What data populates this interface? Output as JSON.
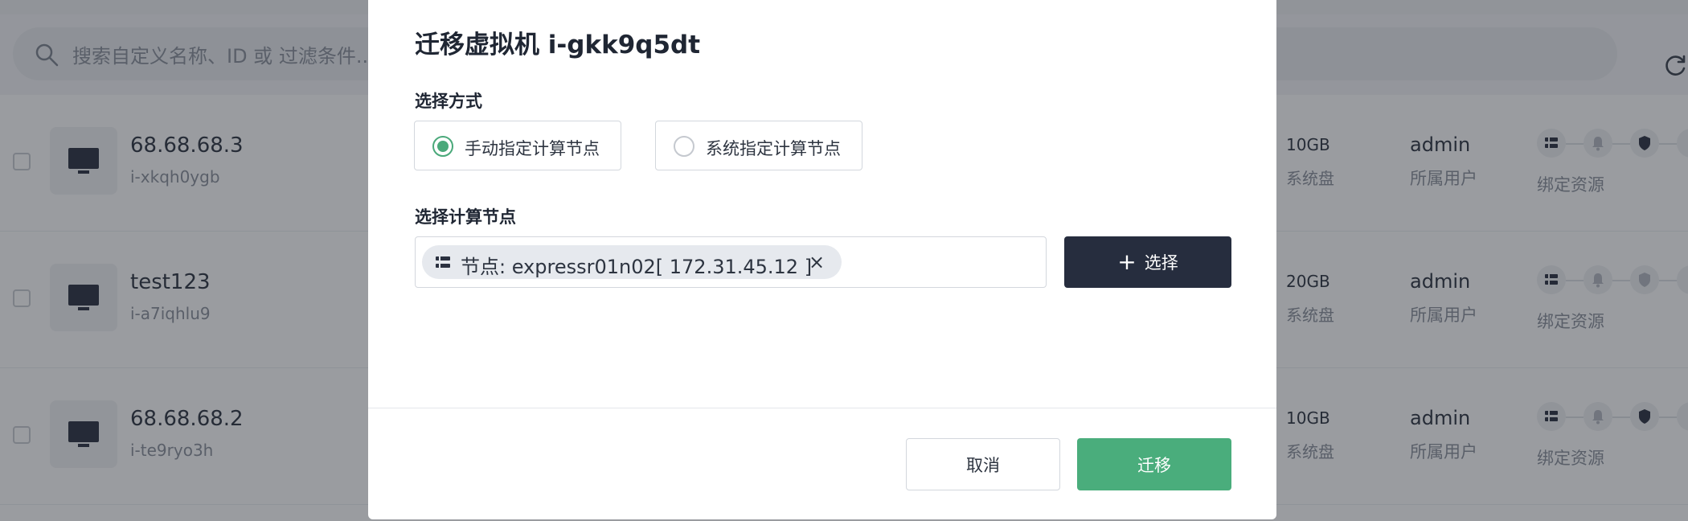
{
  "search": {
    "placeholder": "搜索自定义名称、ID 或 过滤条件..."
  },
  "rows": [
    {
      "name": "68.68.68.3",
      "id": "i-xkqh0ygb",
      "disk": "10GB",
      "disk_label": "系统盘",
      "owner": "admin",
      "owner_label": "所属用户",
      "resource_label": "绑定资源"
    },
    {
      "name": "test123",
      "id": "i-a7iqhlu9",
      "disk": "20GB",
      "disk_label": "系统盘",
      "owner": "admin",
      "owner_label": "所属用户",
      "resource_label": "绑定资源"
    },
    {
      "name": "68.68.68.2",
      "id": "i-te9ryo3h",
      "disk": "10GB",
      "disk_label": "系统盘",
      "owner": "admin",
      "owner_label": "所属用户",
      "resource_label": "绑定资源"
    }
  ],
  "dialog": {
    "title": "迁移虚拟机 i-gkk9q5dt",
    "method_label": "选择方式",
    "options": [
      {
        "label": "手动指定计算节点",
        "selected": true
      },
      {
        "label": "系统指定计算节点",
        "selected": false
      }
    ],
    "node_label": "选择计算节点",
    "node_tag": "节点: expressr01n02[ 172.31.45.12 ]",
    "tag_close": "×",
    "select_button": "选择",
    "select_icon": "+",
    "cancel_button": "取消",
    "migrate_button": "迁移"
  },
  "colors": {
    "accent_green": "#4aad7c",
    "dark_button": "#262d3e",
    "overlay": "rgba(32,36,44,0.45)"
  }
}
